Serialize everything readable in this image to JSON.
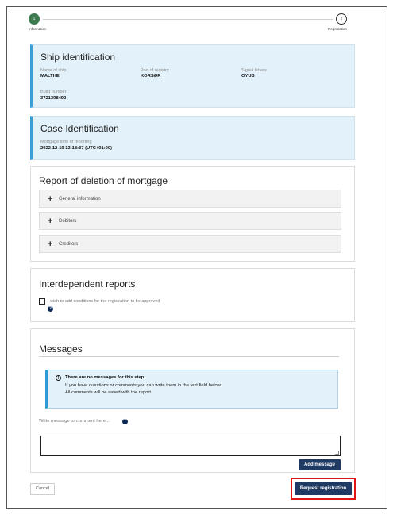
{
  "stepper": {
    "step1_number": "1",
    "step1_label": "Information",
    "step2_number": "2",
    "step2_label": "Registration"
  },
  "ship_identification": {
    "title": "Ship identification",
    "name_label": "Name of ship",
    "name_value": "MALTHE",
    "port_label": "Port of registry",
    "port_value": "KORSØR",
    "signal_label": "Signal letters",
    "signal_value": "OYUB",
    "build_label": "Build number",
    "build_value": "3721398492"
  },
  "case_identification": {
    "title": "Case Identification",
    "time_label": "Mortgage time of reporting",
    "time_value": "2022-12-19 13:18:37 (UTC+01:00)"
  },
  "report": {
    "title": "Report of deletion of mortgage",
    "sections": [
      "General information",
      "Debitors",
      "Creditors"
    ]
  },
  "interdependent": {
    "title": "Interdependent reports",
    "checkbox_label": "I wish to add conditions for the registration to be approved",
    "checked": false
  },
  "messages": {
    "title": "Messages",
    "info_title": "There are no messages for this step.",
    "info_line1": "If you have questions or comments you can write them in the text field below.",
    "info_line2": "All comments will be saved with the report.",
    "input_label": "Write message or comment here...",
    "textarea_value": "",
    "add_button": "Add message"
  },
  "footer": {
    "cancel": "Cancel",
    "request": "Request registration"
  },
  "colors": {
    "step_active": "#3d7a4f",
    "info_accent": "#3b9fd3",
    "button_primary": "#1f3a63",
    "highlight": "#e01515"
  },
  "icons": {
    "help": "question-circle-icon",
    "info": "info-circle-icon",
    "expand": "plus-icon"
  }
}
